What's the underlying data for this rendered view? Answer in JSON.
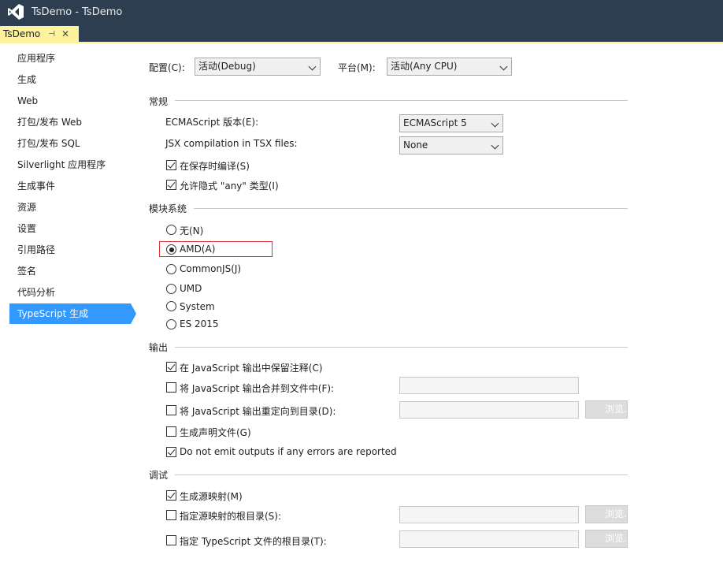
{
  "window": {
    "title": "TsDemo - TsDemo"
  },
  "tab": {
    "label": "TsDemo",
    "pin": "⊣",
    "close": "✕"
  },
  "sidebar": {
    "items": [
      {
        "label": "应用程序"
      },
      {
        "label": "生成"
      },
      {
        "label": "Web"
      },
      {
        "label": "打包/发布 Web"
      },
      {
        "label": "打包/发布 SQL"
      },
      {
        "label": "Silverlight 应用程序"
      },
      {
        "label": "生成事件"
      },
      {
        "label": "资源"
      },
      {
        "label": "设置"
      },
      {
        "label": "引用路径"
      },
      {
        "label": "签名"
      },
      {
        "label": "代码分析"
      },
      {
        "label": "TypeScript 生成"
      }
    ],
    "selected_index": 12
  },
  "config": {
    "config_label": "配置(C):",
    "config_value": "活动(Debug)",
    "platform_label": "平台(M):",
    "platform_value": "活动(Any CPU)"
  },
  "general": {
    "heading": "常规",
    "ecma_label": "ECMAScript 版本(E):",
    "ecma_value": "ECMAScript 5",
    "jsx_label": "JSX compilation in TSX files:",
    "jsx_value": "None",
    "compile_on_save": {
      "label": "在保存时编译(S)",
      "checked": true
    },
    "allow_implicit_any": {
      "label": "允许隐式 \"any\" 类型(I)",
      "checked": true
    }
  },
  "module": {
    "heading": "模块系统",
    "options": [
      {
        "label": "无(N)",
        "checked": false
      },
      {
        "label": "AMD(A)",
        "checked": true
      },
      {
        "label": "CommonJS(J)",
        "checked": false
      },
      {
        "label": "UMD",
        "checked": false
      },
      {
        "label": "System",
        "checked": false
      },
      {
        "label": "ES 2015",
        "checked": false
      }
    ]
  },
  "output": {
    "heading": "输出",
    "keep_comments": {
      "label": "在 JavaScript 输出中保留注释(C)",
      "checked": true
    },
    "combine_output": {
      "label": "将 JavaScript 输出合并到文件中(F):",
      "checked": false
    },
    "redirect_output": {
      "label": "将 JavaScript 输出重定向到目录(D):",
      "checked": false
    },
    "declaration_files": {
      "label": "生成声明文件(G)",
      "checked": false
    },
    "no_emit_on_error": {
      "label": "Do not emit outputs if any errors are reported",
      "checked": true
    },
    "browse_label": "浏览..."
  },
  "debug": {
    "heading": "调试",
    "source_map": {
      "label": "生成源映射(M)",
      "checked": true
    },
    "map_root": {
      "label": "指定源映射的根目录(S):",
      "checked": false
    },
    "ts_root": {
      "label": "指定 TypeScript 文件的根目录(T):",
      "checked": false
    },
    "browse_label": "浏览..."
  },
  "colors": {
    "titlebar": "#2d3e50",
    "tab": "#fff29d",
    "selection": "#3399ff",
    "highlight": "#e03030"
  }
}
